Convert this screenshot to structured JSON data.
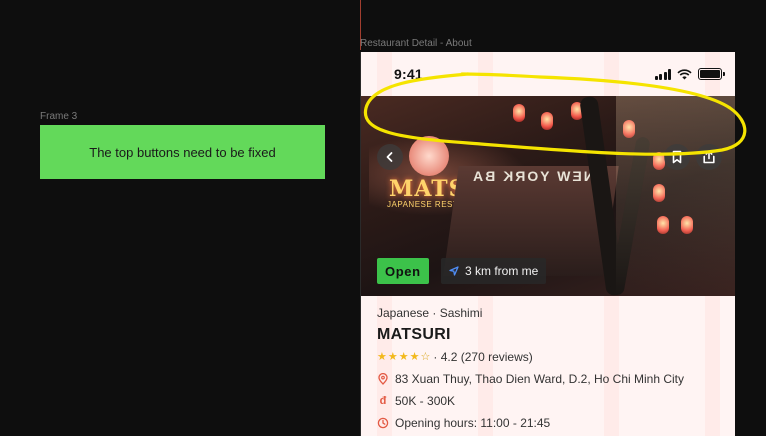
{
  "canvas": {
    "frame3_label": "Frame 3",
    "note_text": "The top buttons need to be fixed",
    "phone_frame_label": "Restaurant Detail - About"
  },
  "status_bar": {
    "time": "9:41"
  },
  "hero": {
    "sign_text": "MATSURI",
    "sign_subtext": "JAPANESE RESTAURANT",
    "wall_text": "NEW YORK BA"
  },
  "badges": {
    "open_label": "Open",
    "distance_label": "3 km from me"
  },
  "restaurant": {
    "category": "Japanese · Sashimi",
    "name": "MATSURI",
    "rating": 4.2,
    "rating_text": "· 4.2 (270 reviews)",
    "address": "83 Xuan Thuy, Thao Dien Ward, D.2, Ho Chi Minh City",
    "price_icon": "đ",
    "price_range": "50K - 300K",
    "opening_hours": "Opening hours: 11:00 - 21:45"
  },
  "icons": {
    "back": "chevron-left-icon",
    "bookmark": "bookmark-icon",
    "share": "share-icon",
    "navigation": "navigation-arrow-icon",
    "location": "location-pin-icon",
    "price": "dong-currency-icon",
    "clock": "clock-icon"
  },
  "colors": {
    "open_green": "#3cc24a",
    "note_green": "#63d95a",
    "star_yellow": "#f2b91c",
    "annotation_yellow": "#f5e400",
    "icon_red": "#e35a44"
  }
}
